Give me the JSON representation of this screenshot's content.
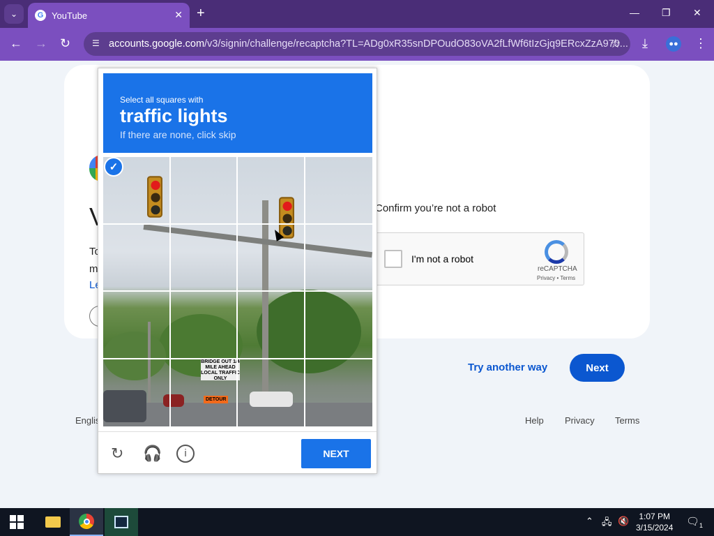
{
  "browser": {
    "tab_title": "YouTube",
    "tab_close": "✕",
    "new_tab": "+",
    "url_host": "accounts.google.com",
    "url_path": "/v3/signin/challenge/recaptcha?TL=ADg0xR35snDPOudO83oVA2fLfWf6tIzGjq9ERcxZzA970...",
    "window_controls": [
      "—",
      "❐",
      "✕"
    ]
  },
  "page": {
    "heading_fragment": "V",
    "text_fragments": [
      "To",
      "m",
      "Le"
    ],
    "confirm_text": "Confirm you’re not a robot",
    "checkbox_label": "I'm not a robot",
    "recaptcha_brand": "reCAPTCHA",
    "recaptcha_links": "Privacy • Terms",
    "try_another": "Try another way",
    "next_label": "Next",
    "footer_language": "Englis",
    "footer_help": "Help",
    "footer_privacy": "Privacy",
    "footer_terms": "Terms"
  },
  "challenge": {
    "instruction": "Select all squares with",
    "object": "traffic lights",
    "skip_hint": "If there are none, click skip",
    "next_button": "NEXT",
    "sign_bridge": "BRIDGE OUT 1/4 MILE AHEAD LOCAL TRAFFIC ONLY",
    "sign_detour": "DETOUR",
    "selected_tiles": [
      0
    ],
    "icons": [
      "reload-icon",
      "audio-icon",
      "info-icon"
    ]
  },
  "taskbar": {
    "time": "1:07 PM",
    "date": "3/15/2024",
    "notification_count": "1"
  }
}
